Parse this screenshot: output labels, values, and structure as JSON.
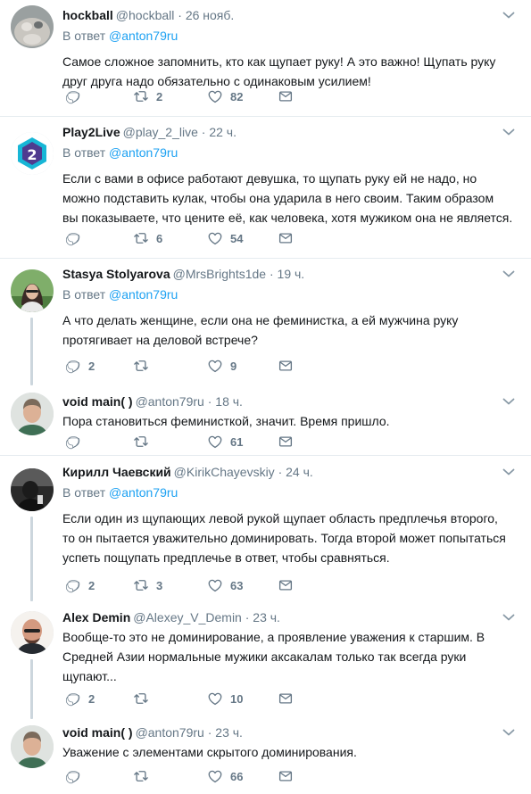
{
  "tweets": [
    {
      "name": "hockball",
      "handle": "@hockball",
      "time": "· 26 нояб.",
      "reply_prefix": "В ответ",
      "reply_mention": "@anton79ru",
      "lines": [
        "Самое сложное запомнить, кто как щупает руку! А это важно! Щупать руку",
        "друг друга надо обязательно с одинаковым усилием!"
      ],
      "reply_count": "",
      "retweet_count": "2",
      "like_count": "82"
    },
    {
      "name": "Play2Live",
      "handle": "@play_2_live",
      "time": "· 22 ч.",
      "reply_prefix": "В ответ",
      "reply_mention": "@anton79ru",
      "lines": [
        "Если с вами в офисе работают девушка, то щупать руку ей не надо, но",
        "можно подставить кулак, чтобы она ударила в него своим. Таким образом",
        "вы показываете, что цените её, как человека, хотя мужиком она не является."
      ],
      "reply_count": "",
      "retweet_count": "6",
      "like_count": "54"
    },
    {
      "name": "Stasya Stolyarova",
      "handle": "@MrsBrights1de",
      "time": "· 19 ч.",
      "reply_prefix": "В ответ",
      "reply_mention": "@anton79ru",
      "lines": [
        "А что делать женщине, если она не феминистка, а ей мужчина руку",
        "протягивает на деловой встрече?"
      ],
      "reply_count": "2",
      "retweet_count": "",
      "like_count": "9"
    },
    {
      "name": "void main( )",
      "handle": "@anton79ru",
      "time": "· 18 ч.",
      "lines": [
        "Пора становиться феминисткой, значит. Время пришло."
      ],
      "reply_count": "",
      "retweet_count": "",
      "like_count": "61"
    },
    {
      "name": "Кирилл Чаевский",
      "handle": "@KirikChayevskiy",
      "time": "· 24 ч.",
      "reply_prefix": "В ответ",
      "reply_mention": "@anton79ru",
      "lines": [
        "Если один из щупающих левой рукой щупает область предплечья второго,",
        "то он пытается уважительно доминировать. Тогда второй может попытаться",
        "успеть пощупать предплечье в ответ, чтобы сравняться."
      ],
      "reply_count": "2",
      "retweet_count": "3",
      "like_count": "63"
    },
    {
      "name": "Alex Demin",
      "handle": "@Alexey_V_Demin",
      "time": "· 23 ч.",
      "lines": [
        "Вообще-то это не доминирование, а проявление уважения к старшим. В",
        "Средней Азии нормальные мужики аксакалам только так всегда руки",
        "щупают..."
      ],
      "reply_count": "2",
      "retweet_count": "",
      "like_count": "10"
    },
    {
      "name": "void main( )",
      "handle": "@anton79ru",
      "time": "· 23 ч.",
      "lines": [
        "Уважение с элементами скрытого доминирования."
      ],
      "reply_count": "",
      "retweet_count": "",
      "like_count": "66"
    }
  ],
  "colors": {
    "text": "#14171a",
    "secondary": "#657786",
    "link": "#1da1f2",
    "divider": "#e6ecf0",
    "thread_line": "#ccd6dd"
  },
  "icons": [
    "reply-icon",
    "retweet-icon",
    "like-icon",
    "message-icon",
    "chevron-down-icon"
  ]
}
